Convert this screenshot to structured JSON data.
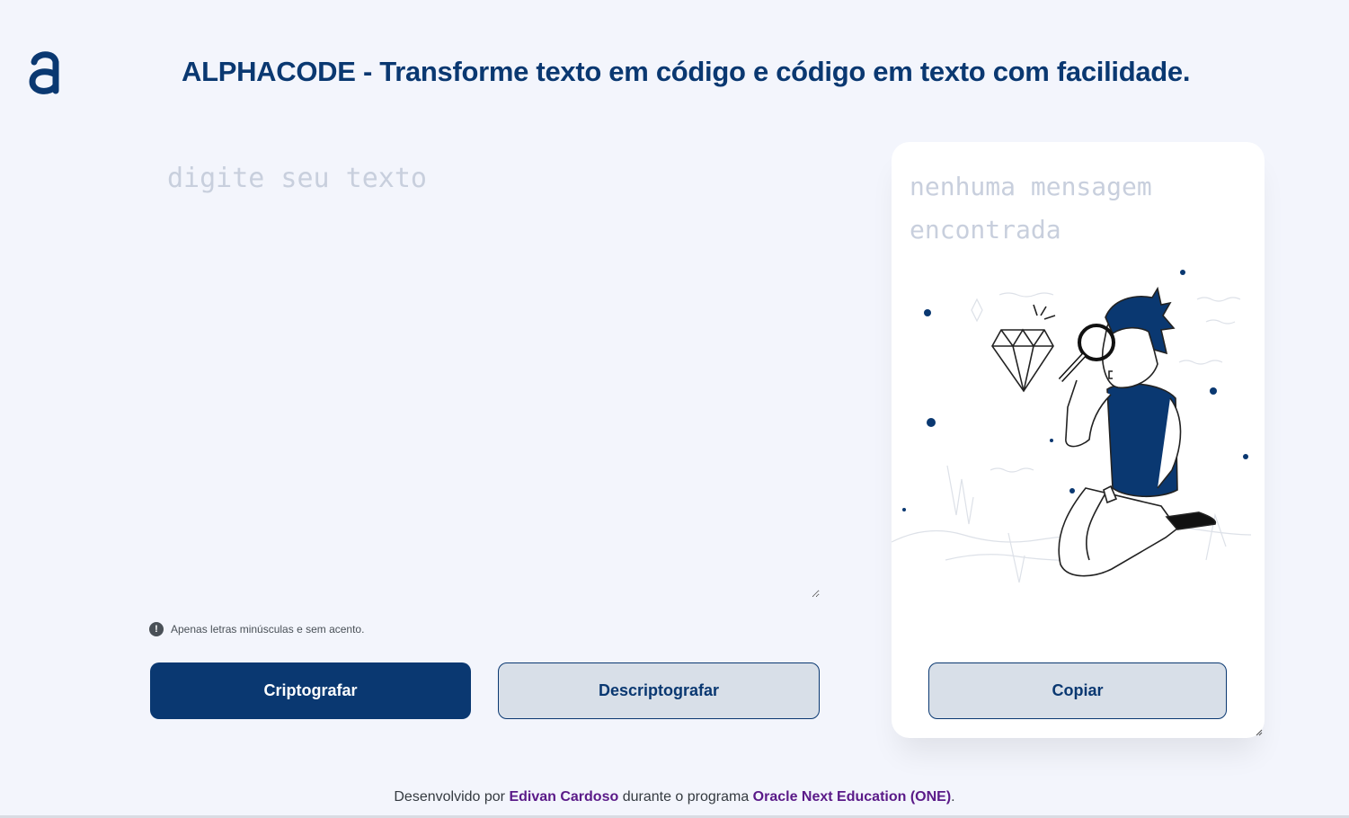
{
  "header": {
    "logo_icon": "alphacode-logo-icon",
    "title": "ALPHACODE - Transforme texto em código e código em texto com facilidade."
  },
  "input": {
    "placeholder": "digite seu texto",
    "value": ""
  },
  "hint": {
    "icon": "exclamation-circle-icon",
    "text": "Apenas letras minúsculas e sem acento."
  },
  "actions": {
    "encrypt_label": "Criptografar",
    "decrypt_label": "Descriptografar"
  },
  "output": {
    "empty_message": "nenhuma mensagem encontrada",
    "illustration": "person-with-magnifier-diamond-illustration",
    "copy_label": "Copiar"
  },
  "footer": {
    "prefix": "Desenvolvido por ",
    "author": "Edivan Cardoso",
    "middle": " durante o programa ",
    "program": "Oracle Next Education (ONE)",
    "suffix": "."
  },
  "colors": {
    "brand": "#0a3871",
    "background": "#f3f5fc",
    "secondary_button": "#d8dfe8",
    "footer_accent": "#5a1a88"
  }
}
